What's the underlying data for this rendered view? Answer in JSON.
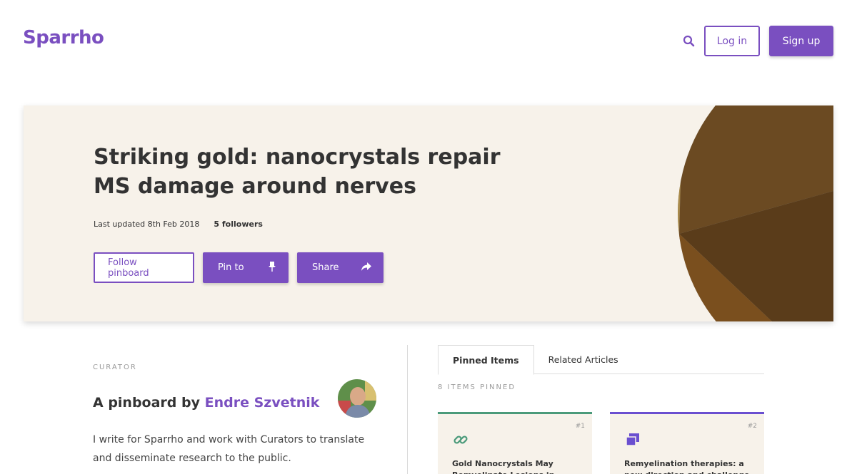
{
  "header": {
    "logo": "Sparrho",
    "login_label": "Log in",
    "signup_label": "Sign up",
    "search_icon": "search-icon"
  },
  "hero": {
    "title": "Striking gold: nanocrystals repair MS damage around nerves",
    "last_updated": "Last updated 8th Feb 2018",
    "followers": "5 followers",
    "follow_label": "Follow pinboard",
    "pin_label": "Pin to",
    "share_label": "Share"
  },
  "curator": {
    "section_label": "CURATOR",
    "prefix": "A pinboard by",
    "name": "Endre Szvetnik",
    "bio": "I write for Sparrho and work with Curators to translate and disseminate research to the public."
  },
  "tabs": [
    {
      "label": "Pinned Items",
      "active": true
    },
    {
      "label": "Related Articles",
      "active": false
    }
  ],
  "items_count": "8 ITEMS PINNED",
  "cards": [
    {
      "num": "#1",
      "title": "Gold Nanocrystals May Remyelinate Lesions in Multiple",
      "icon": "link-icon",
      "accent": "#4a9a7a"
    },
    {
      "num": "#2",
      "title": "Remyelination therapies: a new direction and challenge in",
      "icon": "pages-icon",
      "accent": "#6a4fd0"
    }
  ],
  "colors": {
    "brand": "#7a4fc0",
    "hero_bg": "#f7f2ea"
  }
}
